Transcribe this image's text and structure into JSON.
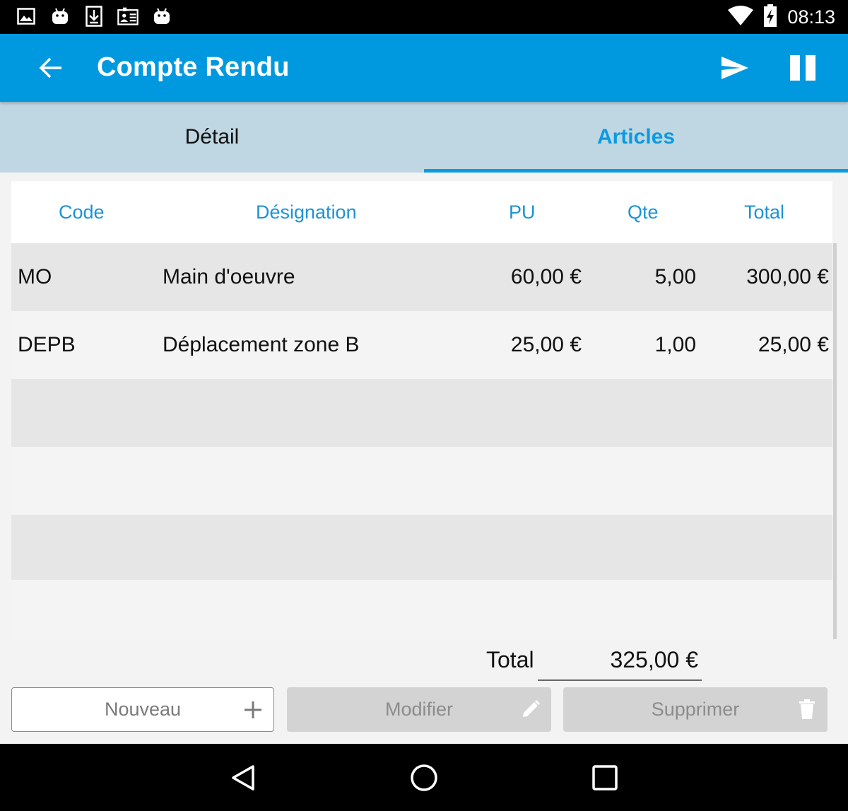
{
  "status_bar": {
    "time": "08:13",
    "left_icons": [
      "image-icon",
      "android-icon",
      "download-icon",
      "contact-card-icon",
      "android-icon"
    ],
    "right_icons": [
      "wifi-icon",
      "battery-charging-icon"
    ]
  },
  "app_bar": {
    "title": "Compte Rendu",
    "background": "#0099df",
    "icons": [
      "back-arrow-icon",
      "send-icon",
      "pause-icon"
    ]
  },
  "tabs": [
    {
      "label": "Détail",
      "active": false
    },
    {
      "label": "Articles",
      "active": true
    }
  ],
  "table": {
    "headers": {
      "code": "Code",
      "designation": "Désignation",
      "pu": "PU",
      "qte": "Qte",
      "total": "Total"
    },
    "rows": [
      {
        "code": "MO",
        "designation": "Main d'oeuvre",
        "pu": "60,00 €",
        "qte": "5,00",
        "total": "300,00 €"
      },
      {
        "code": "DEPB",
        "designation": "Déplacement zone B",
        "pu": "25,00 €",
        "qte": "1,00",
        "total": "25,00 €"
      }
    ]
  },
  "summary": {
    "total_label": "Total",
    "total_value": "325,00 €"
  },
  "actions": {
    "new_label": "Nouveau",
    "edit_label": "Modifier",
    "delete_label": "Supprimer"
  },
  "nav_bar": {
    "icons": [
      "back-triangle-icon",
      "home-circle-icon",
      "recents-square-icon"
    ]
  }
}
